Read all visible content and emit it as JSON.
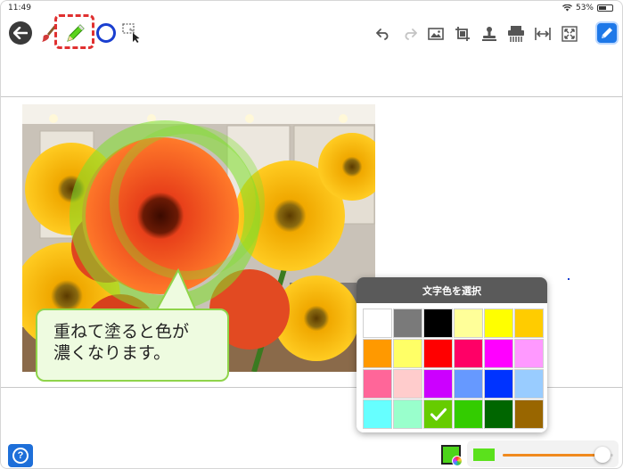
{
  "status_bar": {
    "time": "11:49",
    "battery_percent": "53%"
  },
  "toolbar": {
    "icons": [
      "back-arrow-icon",
      "brush-icon",
      "pen-icon",
      "circle-icon",
      "select-icon",
      "undo-icon",
      "redo-icon",
      "image-icon",
      "crop-icon",
      "stamp-icon",
      "shredder-icon",
      "fit-width-icon",
      "fit-screen-icon",
      "edit-pen-icon"
    ],
    "accent": "#1e78e8",
    "highlight_color": "#e03030"
  },
  "callout": {
    "text": "重ねて塗ると色が\n濃くなります。"
  },
  "color_picker": {
    "title": "文字色を選択",
    "selected_index": 20,
    "colors": [
      "#ffffff",
      "#7a7a7a",
      "#000000",
      "#ffff99",
      "#ffff00",
      "#ffcc00",
      "#ff9900",
      "#ffff66",
      "#ff0000",
      "#ff0066",
      "#ff00ff",
      "#ff99ff",
      "#ff6699",
      "#ffcccc",
      "#cc00ff",
      "#6699ff",
      "#0033ff",
      "#99ccff",
      "#66ffff",
      "#99ffcc",
      "#66cc00",
      "#33cc00",
      "#006600",
      "#996600"
    ]
  },
  "bottom_bar": {
    "current_color": "#4cd41a",
    "pen_width_level": 0.9
  }
}
